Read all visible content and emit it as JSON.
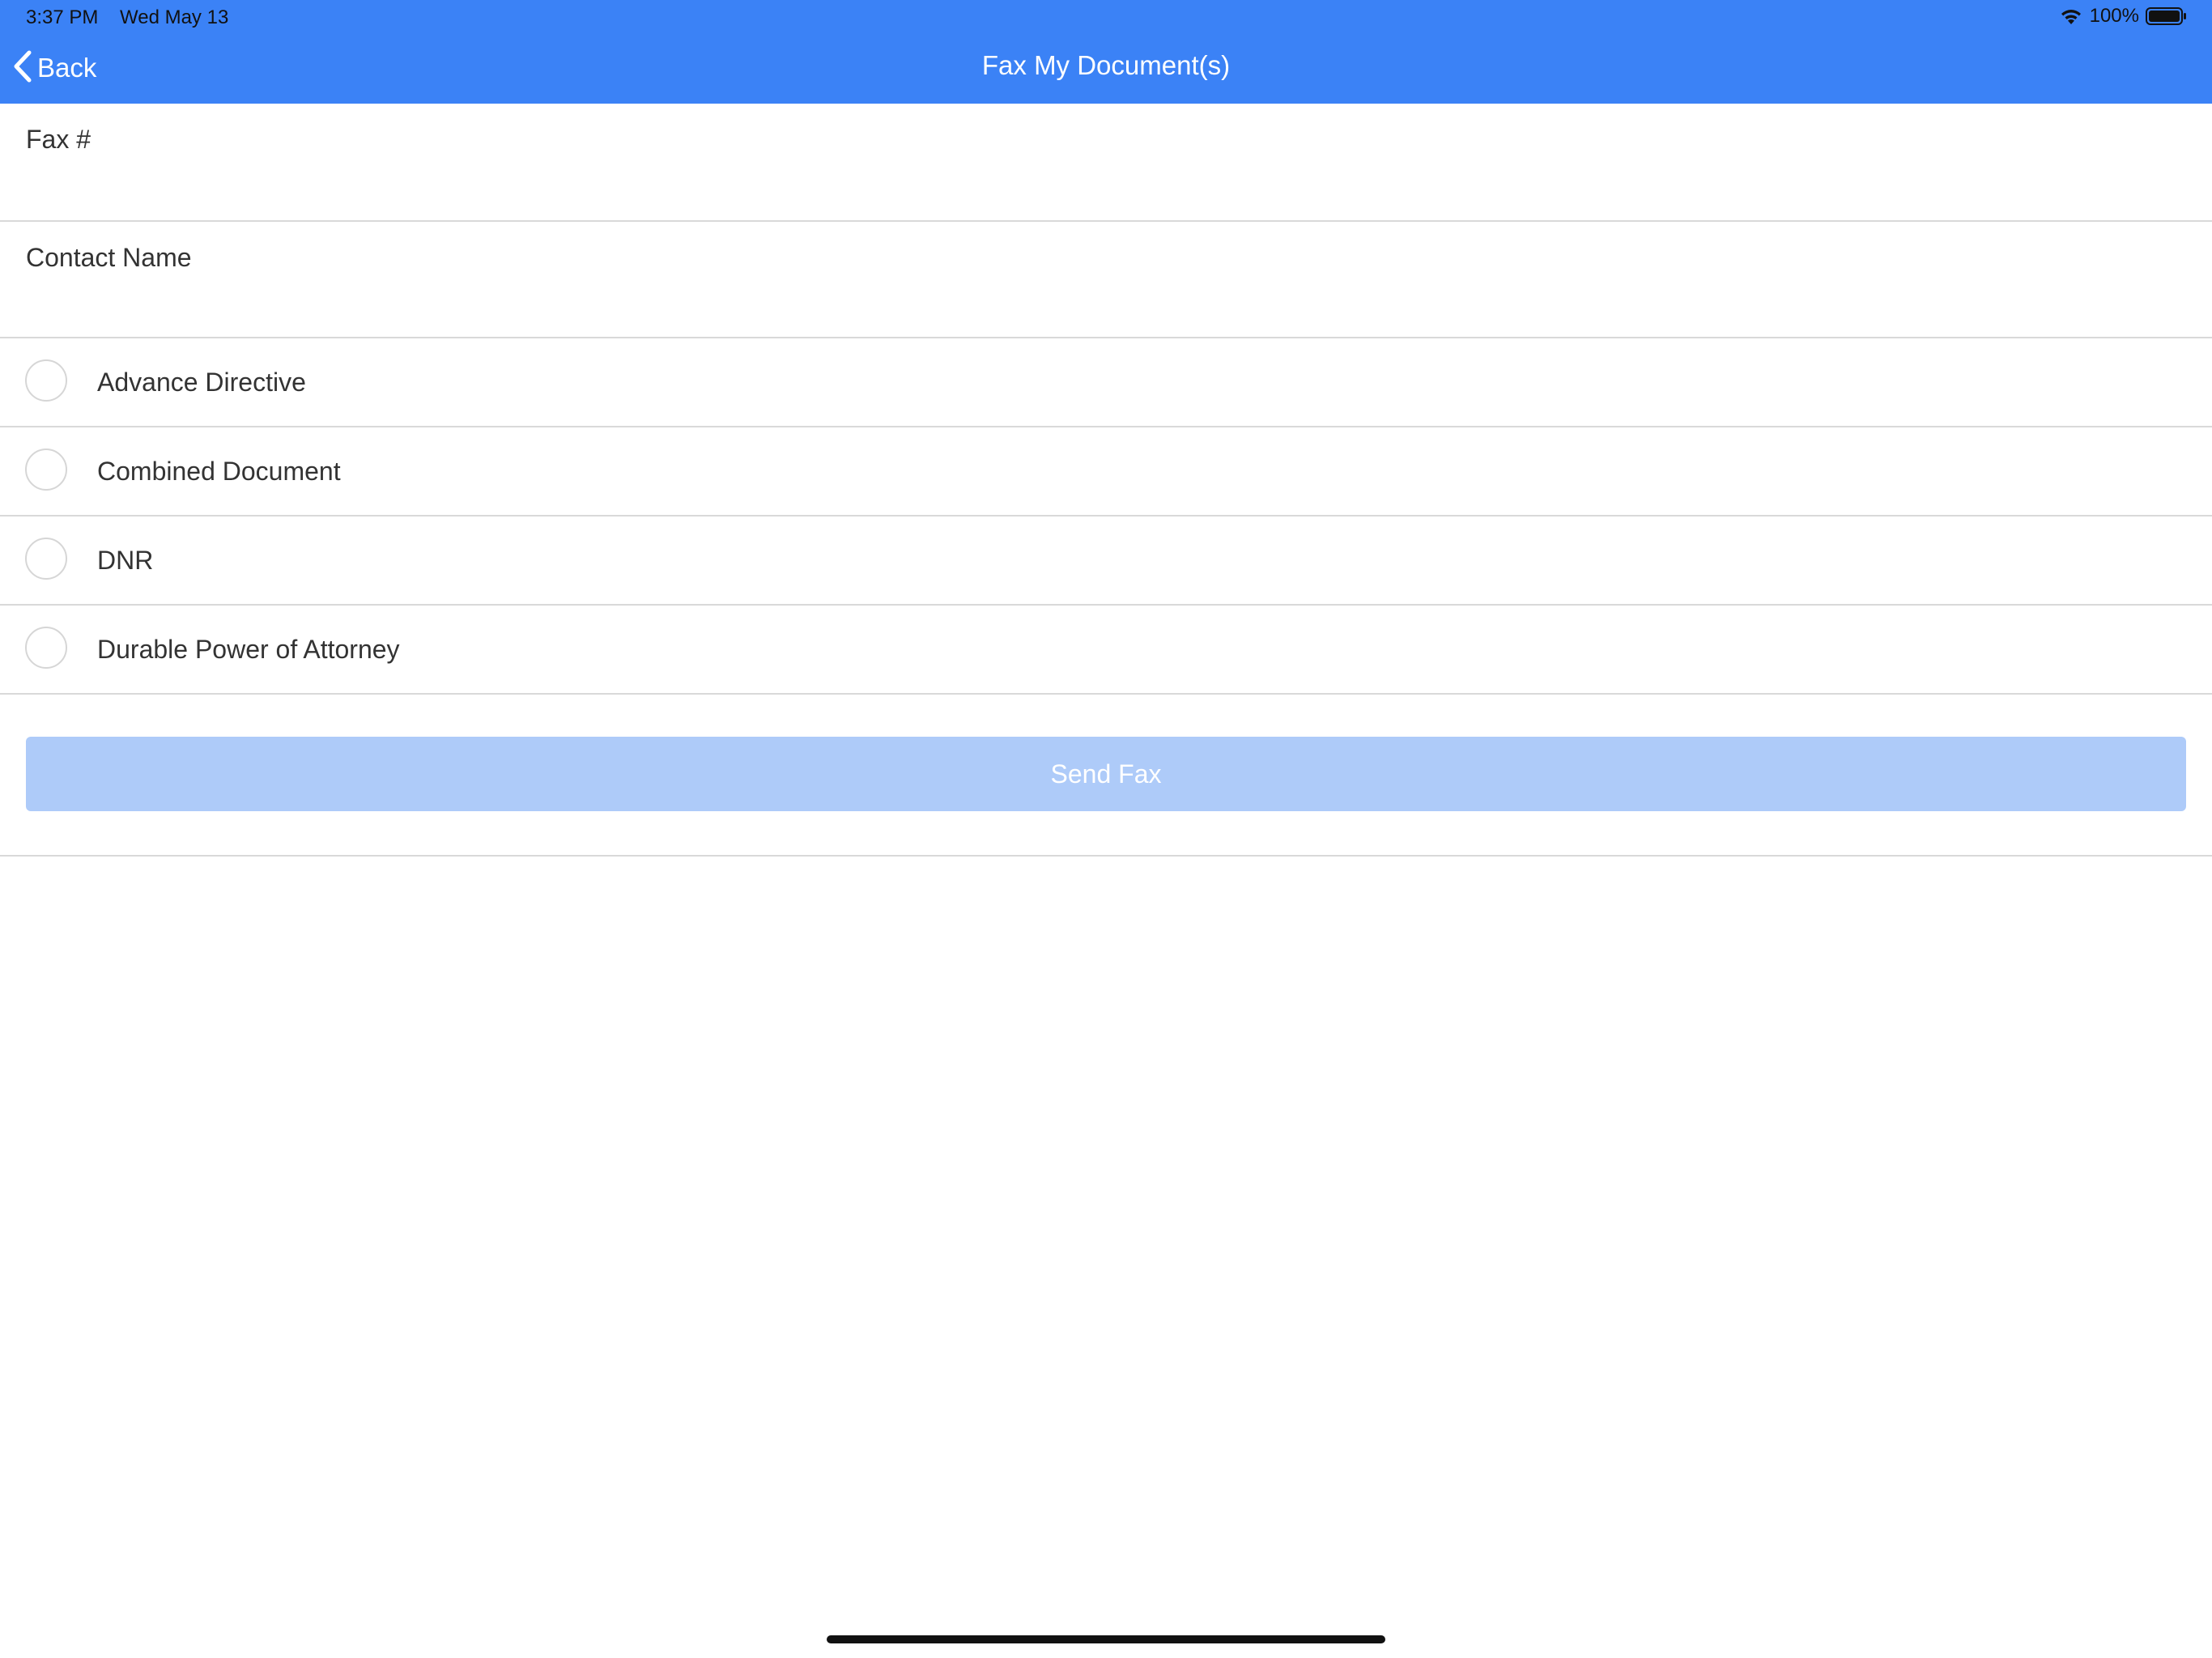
{
  "status_bar": {
    "time": "3:37 PM",
    "date": "Wed May 13",
    "battery_percent": "100%",
    "icons": [
      "wifi-icon",
      "battery-icon"
    ]
  },
  "nav": {
    "back_label": "Back",
    "title": "Fax My Document(s)",
    "back_icon": "chevron-left-icon"
  },
  "form": {
    "fax_label": "Fax #",
    "fax_value": "",
    "contact_label": "Contact Name",
    "contact_value": ""
  },
  "documents": [
    {
      "label": "Advance Directive",
      "selected": false
    },
    {
      "label": "Combined Document",
      "selected": false
    },
    {
      "label": "DNR",
      "selected": false
    },
    {
      "label": "Durable Power of Attorney",
      "selected": false
    }
  ],
  "actions": {
    "send_label": "Send Fax"
  },
  "colors": {
    "header_bg": "#3b82f6",
    "send_button_disabled": "#aecbf9",
    "divider": "#d9d9d9"
  }
}
